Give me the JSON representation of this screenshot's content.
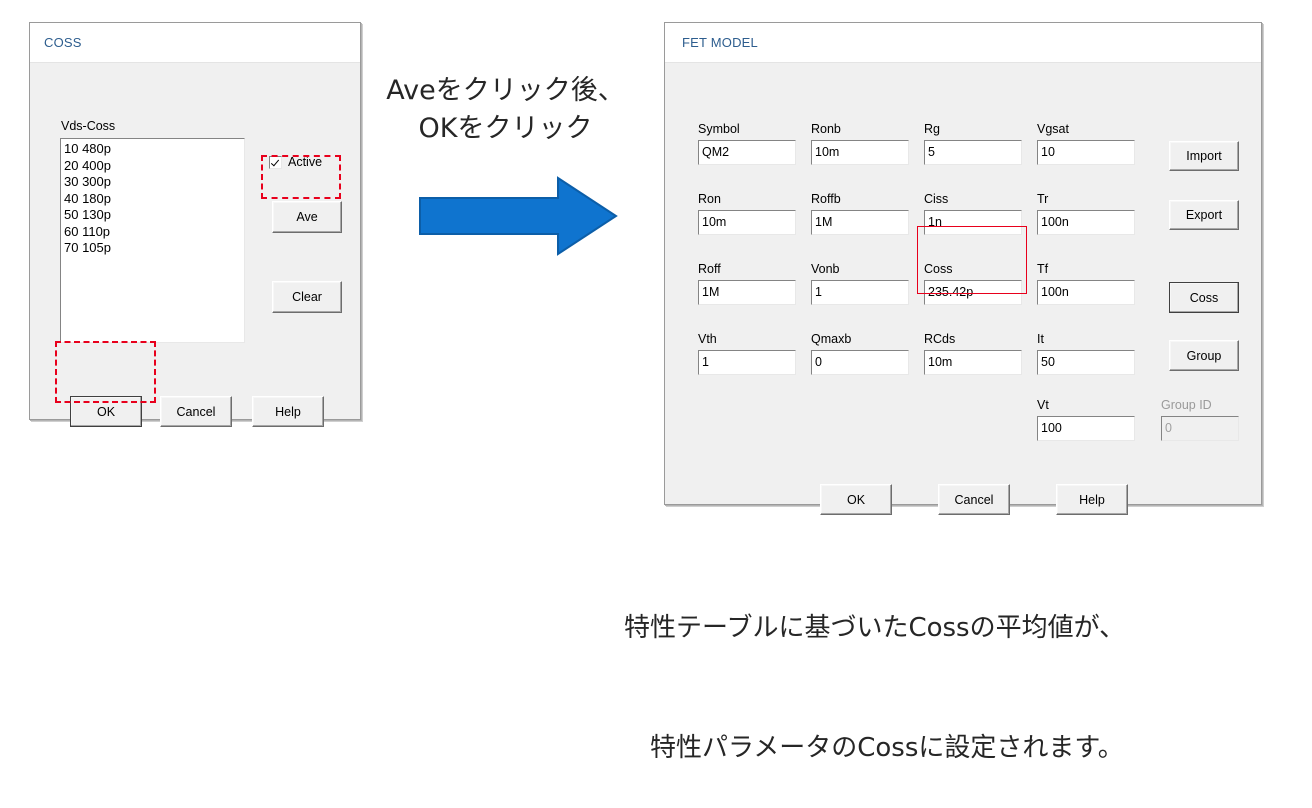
{
  "coss_dialog": {
    "title": "COSS",
    "list_label": "Vds-Coss",
    "list_items": [
      "10 480p",
      "20 400p",
      "30 300p",
      "40 180p",
      "50 130p",
      "60 110p",
      "70 105p"
    ],
    "checkbox": {
      "label": "Active",
      "checked": true
    },
    "buttons": {
      "ave": "Ave",
      "clear": "Clear",
      "ok": "OK",
      "cancel": "Cancel",
      "help": "Help"
    }
  },
  "fet_dialog": {
    "title": "FET MODEL",
    "fields": [
      {
        "label": "Symbol",
        "value": "QM2",
        "col": 0,
        "row": 0,
        "disabled": false
      },
      {
        "label": "Ron",
        "value": "10m",
        "col": 0,
        "row": 1,
        "disabled": false
      },
      {
        "label": "Roff",
        "value": "1M",
        "col": 0,
        "row": 2,
        "disabled": false
      },
      {
        "label": "Vth",
        "value": "1",
        "col": 0,
        "row": 3,
        "disabled": false
      },
      {
        "label": "Ronb",
        "value": "10m",
        "col": 1,
        "row": 0,
        "disabled": false
      },
      {
        "label": "Roffb",
        "value": "1M",
        "col": 1,
        "row": 1,
        "disabled": false
      },
      {
        "label": "Vonb",
        "value": "1",
        "col": 1,
        "row": 2,
        "disabled": false
      },
      {
        "label": "Qmaxb",
        "value": "0",
        "col": 1,
        "row": 3,
        "disabled": false
      },
      {
        "label": "Rg",
        "value": "5",
        "col": 2,
        "row": 0,
        "disabled": false
      },
      {
        "label": "Ciss",
        "value": "1n",
        "col": 2,
        "row": 1,
        "disabled": false
      },
      {
        "label": "Coss",
        "value": "235.42p",
        "col": 2,
        "row": 2,
        "disabled": false
      },
      {
        "label": "RCds",
        "value": "10m",
        "col": 2,
        "row": 3,
        "disabled": false
      },
      {
        "label": "Vgsat",
        "value": "10",
        "col": 3,
        "row": 0,
        "disabled": false
      },
      {
        "label": "Tr",
        "value": "100n",
        "col": 3,
        "row": 1,
        "disabled": false
      },
      {
        "label": "Tf",
        "value": "100n",
        "col": 3,
        "row": 2,
        "disabled": false
      },
      {
        "label": "It",
        "value": "50",
        "col": 3,
        "row": 3,
        "disabled": false
      },
      {
        "label": "Vt",
        "value": "100",
        "col": 3,
        "row": 4,
        "disabled": false
      }
    ],
    "side_buttons": [
      "Import",
      "Export",
      "Coss",
      "Group"
    ],
    "group_id": {
      "label": "Group ID",
      "value": "0",
      "disabled": true
    },
    "buttons": {
      "ok": "OK",
      "cancel": "Cancel",
      "help": "Help"
    }
  },
  "annotations": {
    "step_note": "Aveをクリック後、\nOKをクリック",
    "caption_line1": "特性テーブルに基づいたCossの平均値が、",
    "caption_line2": "特性パラメータのCossに設定されます。",
    "arrow_color": "#0f74cf",
    "highlight_color": "#e8001c"
  }
}
